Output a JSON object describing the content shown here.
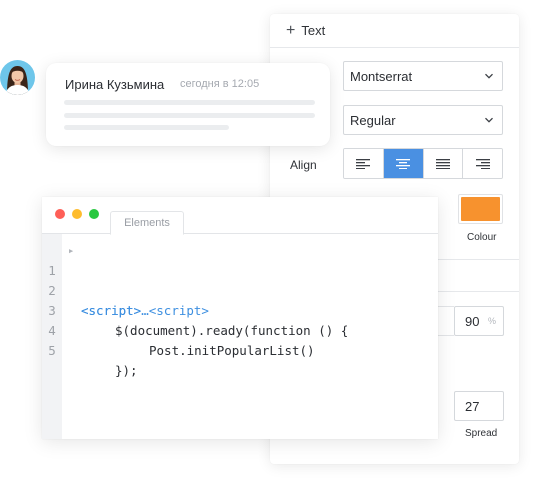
{
  "colors": {
    "accent": "#4a90e2",
    "colour_swatch": "#f7922e",
    "tag_blue": "#3d8fe0",
    "dot_red": "#fe5f57",
    "dot_yellow": "#febc2e",
    "dot_green": "#28c840"
  },
  "props": {
    "header_icon": "plus-icon",
    "header_label": "Text",
    "font_family": "Montserrat",
    "font_weight": "Regular",
    "align_label": "Align",
    "align_options": [
      "align-left",
      "align-center",
      "align-justify",
      "align-right"
    ],
    "align_selected": "align-center",
    "colour_label": "Colour",
    "opacity_value": "90",
    "opacity_unit": "%",
    "spread_value": "27",
    "spread_label": "Spread"
  },
  "chat": {
    "author": "Ирина Кузьмина",
    "time": "сегодня в 12:05"
  },
  "devtools": {
    "tab_label": "Elements",
    "lines": [
      {
        "num": "1",
        "parts": [
          {
            "text": "<script>",
            "tag": true
          },
          {
            "text": "…",
            "tag": false
          },
          {
            "text": "<script>",
            "tag": true
          }
        ]
      },
      {
        "num": "2",
        "parts": [
          {
            "text": "<script>",
            "tag": true
          }
        ]
      },
      {
        "num": "3",
        "parts": [
          {
            "text": "$(document).ready(function () {",
            "tag": false
          }
        ]
      },
      {
        "num": "4",
        "parts": [
          {
            "text": "Post.initPopularList()",
            "tag": false
          }
        ]
      },
      {
        "num": "5",
        "parts": [
          {
            "text": "});",
            "tag": false
          }
        ]
      }
    ]
  }
}
